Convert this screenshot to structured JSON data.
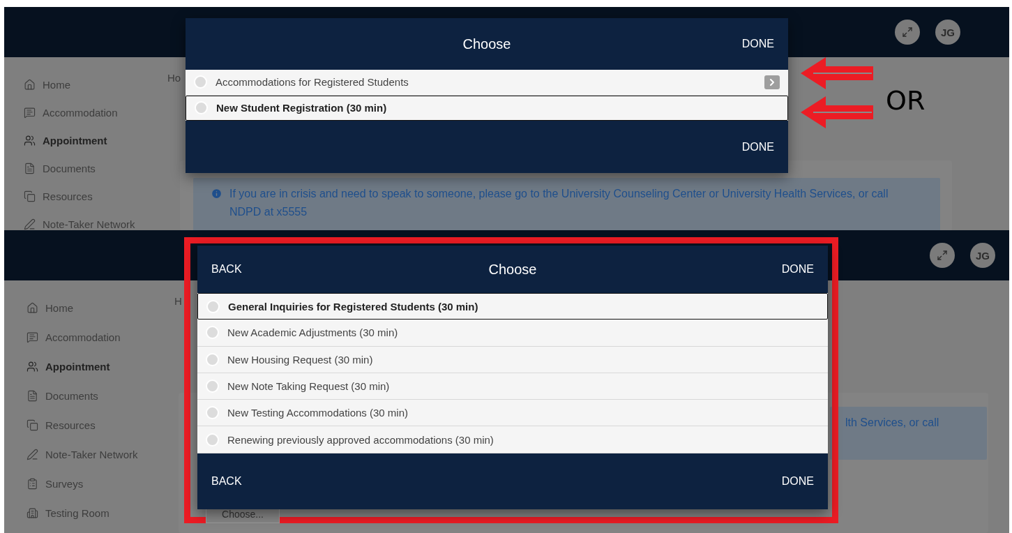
{
  "panels": [
    {
      "header": {
        "avatar": "JG"
      },
      "sidebar": [
        {
          "label": "Home",
          "selected": false
        },
        {
          "label": "Accommodation",
          "selected": false
        },
        {
          "label": "Appointment",
          "selected": true
        },
        {
          "label": "Documents",
          "selected": false
        },
        {
          "label": "Resources",
          "selected": false
        },
        {
          "label": "Note-Taker Network",
          "selected": false
        }
      ],
      "breadcrumb": "Ho",
      "alert": "If you are in crisis and need to speak to someone, please go to the University Counseling Center or University Health Services, or call NDPD at x5555",
      "dialog": {
        "title": "Choose",
        "done_top": "DONE",
        "done_bottom": "DONE",
        "options": [
          {
            "label": "Accommodations for Registered Students",
            "focused": false,
            "kind": "group"
          },
          {
            "label": "New Student Registration (30 min)",
            "focused": true,
            "kind": "item"
          }
        ]
      },
      "annotation": {
        "text": "OR"
      }
    },
    {
      "header": {
        "avatar": "JG"
      },
      "sidebar": [
        {
          "label": "Home",
          "selected": false
        },
        {
          "label": "Accommodation",
          "selected": false
        },
        {
          "label": "Appointment",
          "selected": true
        },
        {
          "label": "Documents",
          "selected": false
        },
        {
          "label": "Resources",
          "selected": false
        },
        {
          "label": "Note-Taker Network",
          "selected": false
        },
        {
          "label": "Surveys",
          "selected": false
        },
        {
          "label": "Testing Room",
          "selected": false
        }
      ],
      "breadcrumb": "H",
      "alert": "lth Services, or call",
      "choose_button": "Choose...",
      "dialog": {
        "title": "Choose",
        "back_top": "BACK",
        "back_bottom": "BACK",
        "done_top": "DONE",
        "done_bottom": "DONE",
        "framed": true,
        "options": [
          {
            "label": "General Inquiries for Registered Students (30 min)",
            "focused": true,
            "kind": "item"
          },
          {
            "label": "New Academic Adjustments (30 min)",
            "focused": false,
            "kind": "item"
          },
          {
            "label": "New Housing Request (30 min)",
            "focused": false,
            "kind": "item"
          },
          {
            "label": "New Note Taking Request (30 min)",
            "focused": false,
            "kind": "item"
          },
          {
            "label": "New Testing Accommodations (30 min)",
            "focused": false,
            "kind": "item"
          },
          {
            "label": "Renewing previously approved accommodations (30 min)",
            "focused": false,
            "kind": "item"
          }
        ]
      }
    }
  ]
}
